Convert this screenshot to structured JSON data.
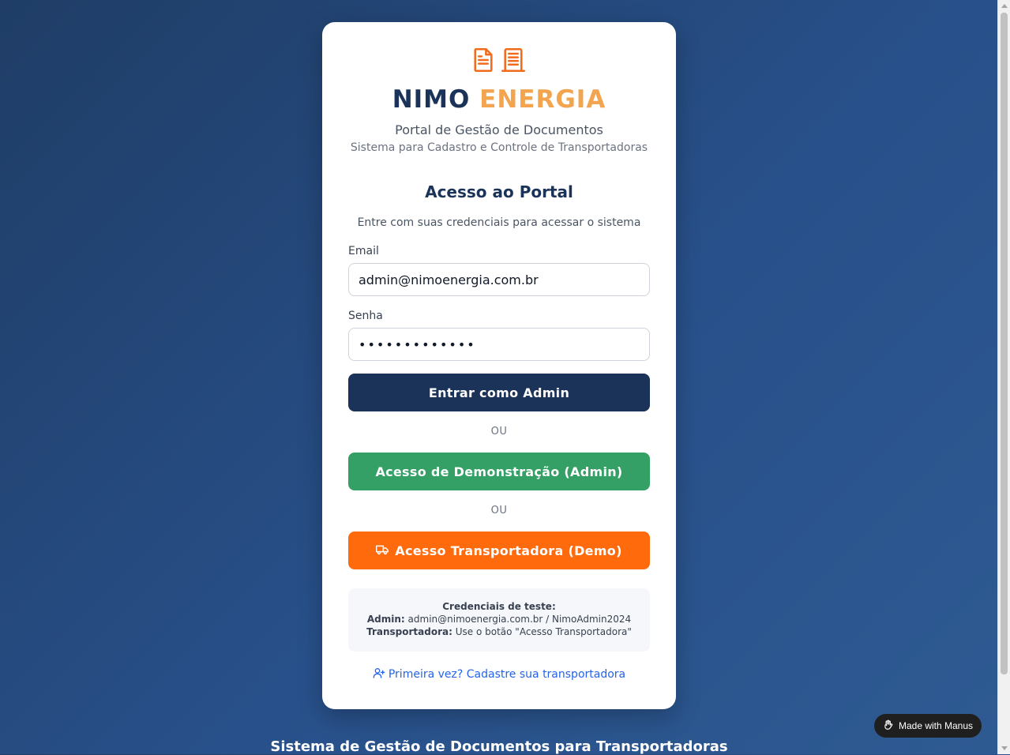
{
  "brand": {
    "name_part1": "NIMO",
    "name_part2": "ENERGIA",
    "subtitle": "Portal de Gestão de Documentos",
    "tagline": "Sistema para Cadastro e Controle de Transportadoras",
    "icons": [
      "file-text-icon",
      "building-icon"
    ]
  },
  "login": {
    "heading": "Acesso ao Portal",
    "description": "Entre com suas credenciais para acessar o sistema",
    "email_label": "Email",
    "email_value": "admin@nimoenergia.com.br",
    "password_label": "Senha",
    "password_value": "•••••••••••••",
    "admin_button": "Entrar como Admin",
    "or_1": "OU",
    "demo_button": "Acesso de Demonstração (Admin)",
    "or_2": "OU",
    "transport_button": "Acesso Transportadora (Demo)"
  },
  "credentials": {
    "title": "Credenciais de teste:",
    "admin_label": "Admin:",
    "admin_value": "admin@nimoenergia.com.br / NimoAdmin2024",
    "transport_label": "Transportadora:",
    "transport_value": "Use o botão \"Acesso Transportadora\""
  },
  "register_link": "Primeira vez? Cadastre sua transportadora",
  "footer_title": "Sistema de Gestão de Documentos para Transportadoras",
  "badge": "Made with Manus",
  "colors": {
    "navy": "#1b3358",
    "orange_light": "#f2a44f",
    "orange": "#ff6a0d",
    "green": "#34a065",
    "link": "#2563eb"
  }
}
